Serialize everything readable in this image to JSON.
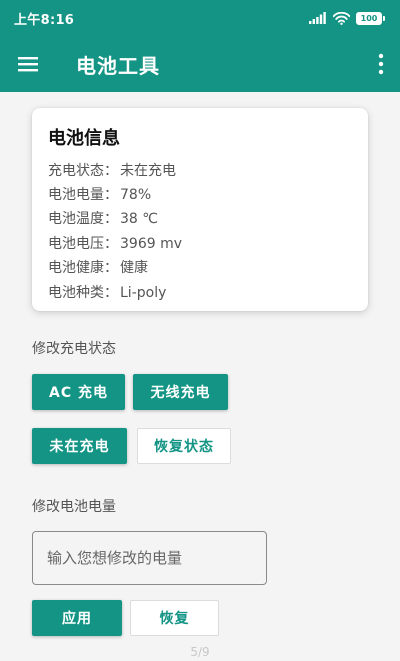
{
  "status_bar": {
    "time": "上午8:16",
    "battery_level": "100"
  },
  "app_bar": {
    "title": "电池工具"
  },
  "battery_card": {
    "title": "电池信息",
    "rows": [
      {
        "label": "充电状态：",
        "value": "未在充电"
      },
      {
        "label": "电池电量：",
        "value": "78%"
      },
      {
        "label": "电池温度：",
        "value": "38 ℃"
      },
      {
        "label": "电池电压：",
        "value": "3969 mv"
      },
      {
        "label": "电池健康：",
        "value": "健康"
      },
      {
        "label": "电池种类：",
        "value": "Li-poly"
      }
    ]
  },
  "charge_section": {
    "label": "修改充电状态",
    "buttons": {
      "ac": "AC 充电",
      "wireless": "无线充电",
      "not_charging": "未在充电",
      "restore": "恢复状态"
    }
  },
  "level_section": {
    "label": "修改电池电量",
    "input_placeholder": "输入您想修改的电量",
    "input_value": "",
    "apply": "应用",
    "restore": "恢复"
  },
  "page_indicator": "5/9",
  "colors": {
    "primary": "#139485",
    "background": "#f4f4f4"
  },
  "icons": {
    "menu": "hamburger-menu-icon",
    "more": "more-vertical-icon",
    "signal": "signal-icon",
    "wifi": "wifi-icon",
    "battery": "battery-icon"
  }
}
